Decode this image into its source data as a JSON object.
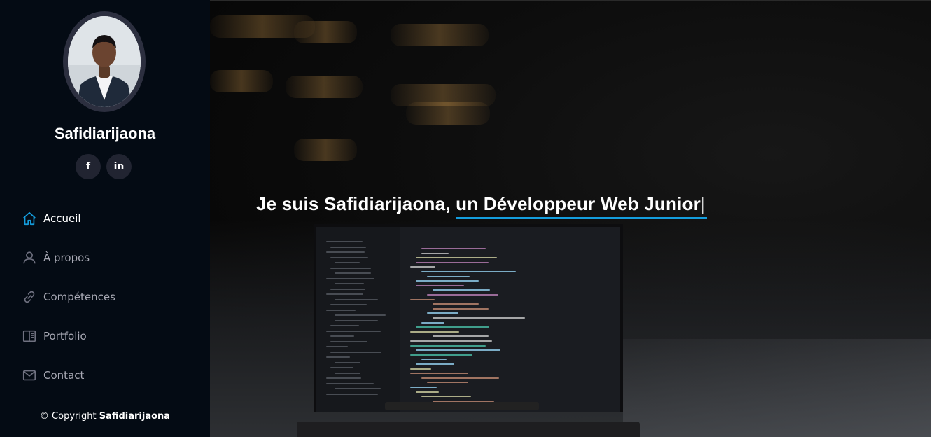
{
  "profile": {
    "name": "Safidiarijaona",
    "avatar_alt": ""
  },
  "socials": [
    {
      "icon": "facebook-icon",
      "glyph": "f"
    },
    {
      "icon": "linkedin-icon",
      "glyph": "in"
    }
  ],
  "nav": {
    "items": [
      {
        "label": "Accueil",
        "icon": "home-icon",
        "active": true
      },
      {
        "label": "À propos",
        "icon": "user-icon",
        "active": false
      },
      {
        "label": "Compétences",
        "icon": "link-icon",
        "active": false
      },
      {
        "label": "Portfolio",
        "icon": "book-icon",
        "active": false
      },
      {
        "label": "Contact",
        "icon": "envelope-icon",
        "active": false
      }
    ]
  },
  "footer": {
    "prefix": "© Copyright",
    "owner": "Safidiarijaona"
  },
  "hero": {
    "intro": "Je suis Safidiarijaona, ",
    "typed": "un Développeur Web Junior",
    "cursor": "|"
  },
  "colors": {
    "accent": "#149ddd",
    "sidebar_bg": "#040b14",
    "social_bg": "#212431",
    "nav_text": "#a8a9b4"
  }
}
